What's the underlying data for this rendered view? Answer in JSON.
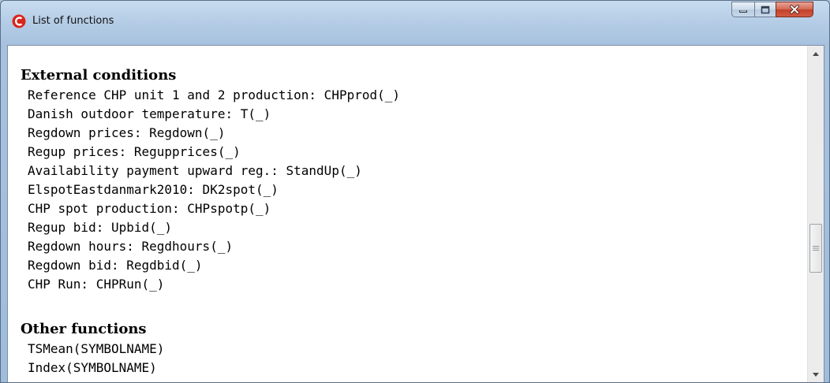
{
  "window": {
    "title": "List of functions",
    "icon": "app-logo-icon",
    "controls": [
      "minimize-icon",
      "maximize-icon",
      "close-icon"
    ]
  },
  "sections": [
    {
      "heading": "External conditions",
      "items": [
        "Reference CHP unit 1 and 2 production: CHPprod(_)",
        "Danish outdoor temperature: T(_)",
        "Regdown prices: Regdown(_)",
        "Regup prices: Regupprices(_)",
        "Availability payment upward reg.: StandUp(_)",
        "ElspotEastdanmark2010: DK2spot(_)",
        "CHP spot production: CHPspotp(_)",
        "Regup bid: Upbid(_)",
        "Regdown hours: Regdhours(_)",
        "Regdown bid: Regdbid(_)",
        "CHP Run: CHPRun(_)"
      ]
    },
    {
      "heading": "Other functions",
      "items": [
        "TSMean(SYMBOLNAME)",
        "Index(SYMBOLNAME)"
      ]
    }
  ],
  "colors": {
    "title_bar": "#b5cde6",
    "close_button": "#c3402a",
    "app_icon": "#d9261c",
    "content_background": "#ffffff"
  }
}
